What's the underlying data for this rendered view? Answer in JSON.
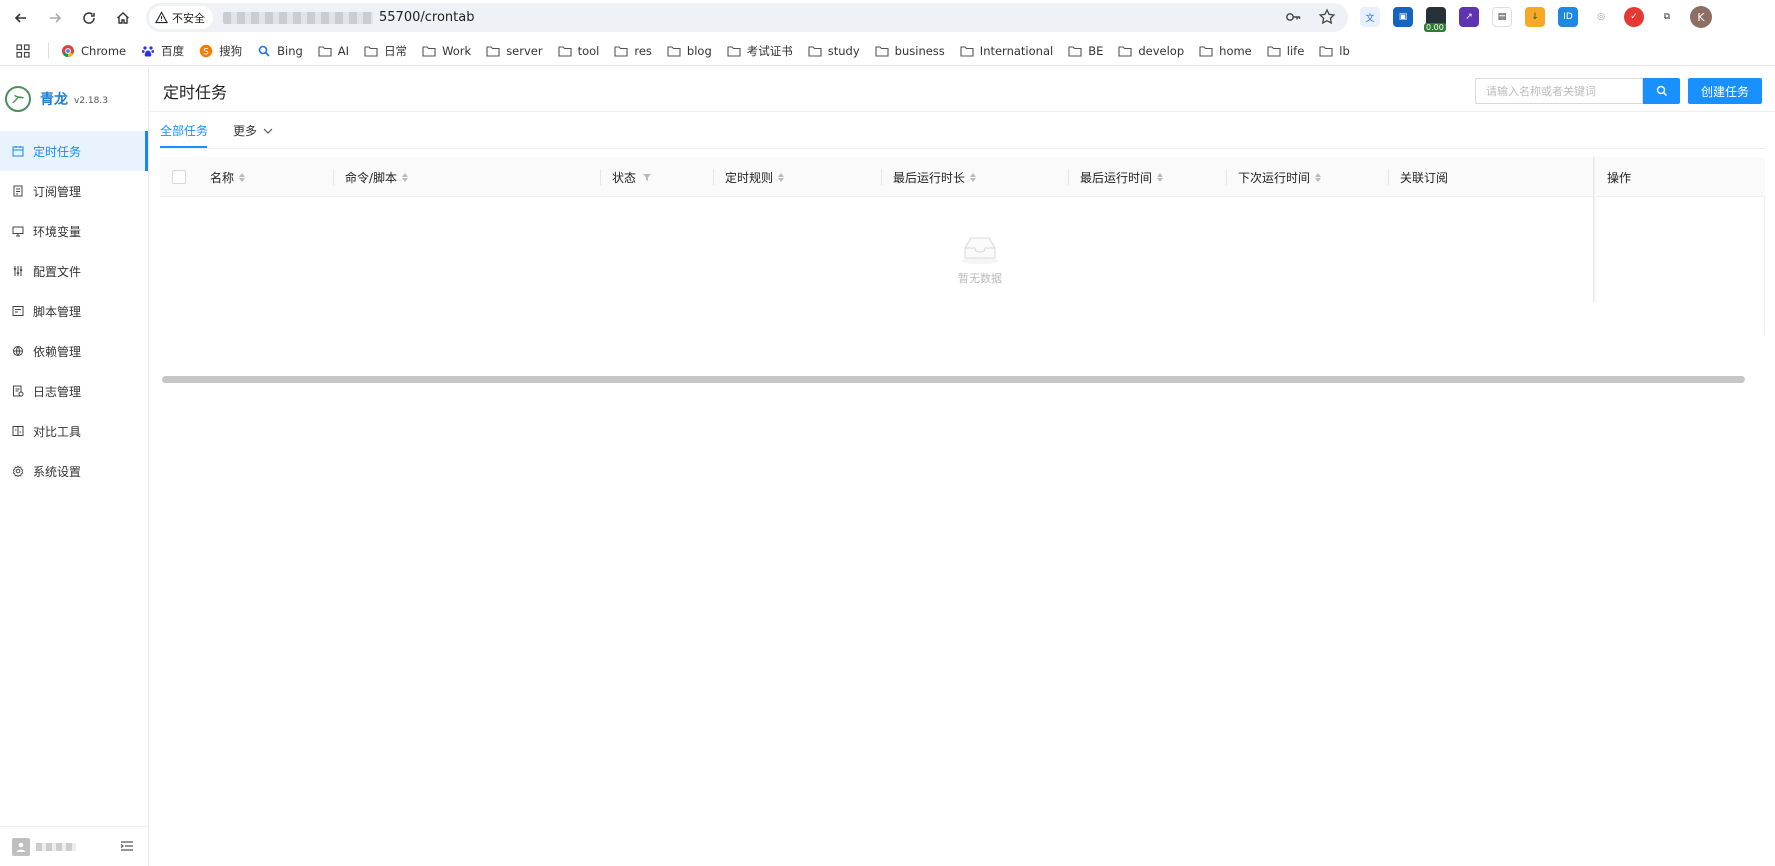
{
  "browser": {
    "security_label": "不安全",
    "url_visible": "55700/crontab",
    "bookmarks": [
      "Chrome",
      "百度",
      "搜狗",
      "Bing",
      "AI",
      "日常",
      "Work",
      "server",
      "tool",
      "res",
      "blog",
      "考试证书",
      "study",
      "business",
      "International",
      "BE",
      "develop",
      "home",
      "life",
      "lb"
    ],
    "extension_badge": "0.00",
    "profile_initial": "K"
  },
  "app": {
    "brand_name": "青龙",
    "version": "v2.18.3",
    "menu": [
      {
        "label": "定时任务",
        "icon": "calendar-icon"
      },
      {
        "label": "订阅管理",
        "icon": "subscription-icon"
      },
      {
        "label": "环境变量",
        "icon": "desktop-icon"
      },
      {
        "label": "配置文件",
        "icon": "sliders-icon"
      },
      {
        "label": "脚本管理",
        "icon": "script-icon"
      },
      {
        "label": "依赖管理",
        "icon": "network-icon"
      },
      {
        "label": "日志管理",
        "icon": "log-icon"
      },
      {
        "label": "对比工具",
        "icon": "diff-icon"
      },
      {
        "label": "系统设置",
        "icon": "gear-icon"
      }
    ],
    "active_menu": "定时任务"
  },
  "page": {
    "title": "定时任务",
    "search_placeholder": "请输入名称或者关键词",
    "create_label": "创建任务",
    "tabs": {
      "all": "全部任务",
      "more": "更多"
    },
    "columns": [
      "名称",
      "命令/脚本",
      "状态",
      "定时规则",
      "最后运行时长",
      "最后运行时间",
      "下次运行时间",
      "关联订阅",
      "操作"
    ],
    "empty_text": "暂无数据"
  },
  "colors": {
    "accent": "#1890ff",
    "brand": "#1a7fd4"
  }
}
